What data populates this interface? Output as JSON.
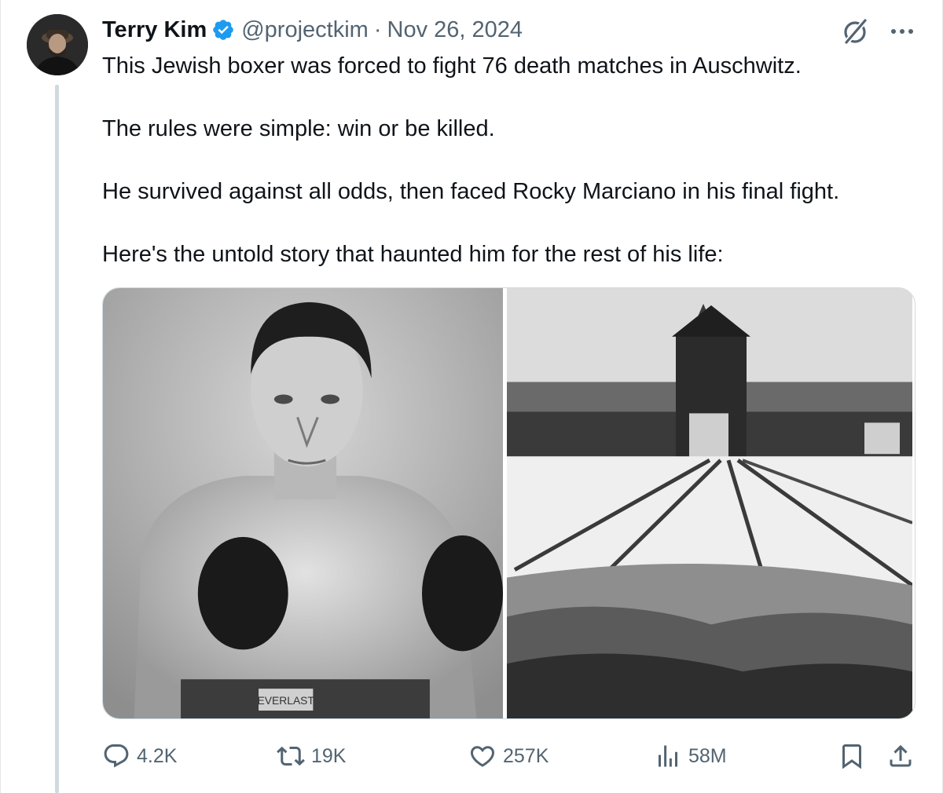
{
  "author": {
    "name": "Terry Kim",
    "handle": "@projectkim",
    "separator": "·",
    "date": "Nov 26, 2024"
  },
  "tweet": {
    "paragraphs": [
      "This Jewish boxer was forced to fight 76 death matches in Auschwitz.",
      "The rules were simple: win or be killed.",
      "He survived against all odds, then faced Rocky Marciano in his final fight.",
      "Here's the untold story that haunted him for the rest of his life:"
    ]
  },
  "media": {
    "left_image_text": "EVERLAST"
  },
  "actions": {
    "replies": "4.2K",
    "reposts": "19K",
    "likes": "257K",
    "views": "58M"
  },
  "colors": {
    "text": "#0f1419",
    "muted": "#536471",
    "verified": "#1d9bf0",
    "thread_line": "#cfd9de"
  },
  "icons": [
    "grok-icon",
    "more-icon",
    "verified-badge-icon",
    "reply-icon",
    "repost-icon",
    "like-icon",
    "views-icon",
    "bookmark-icon",
    "share-icon"
  ]
}
